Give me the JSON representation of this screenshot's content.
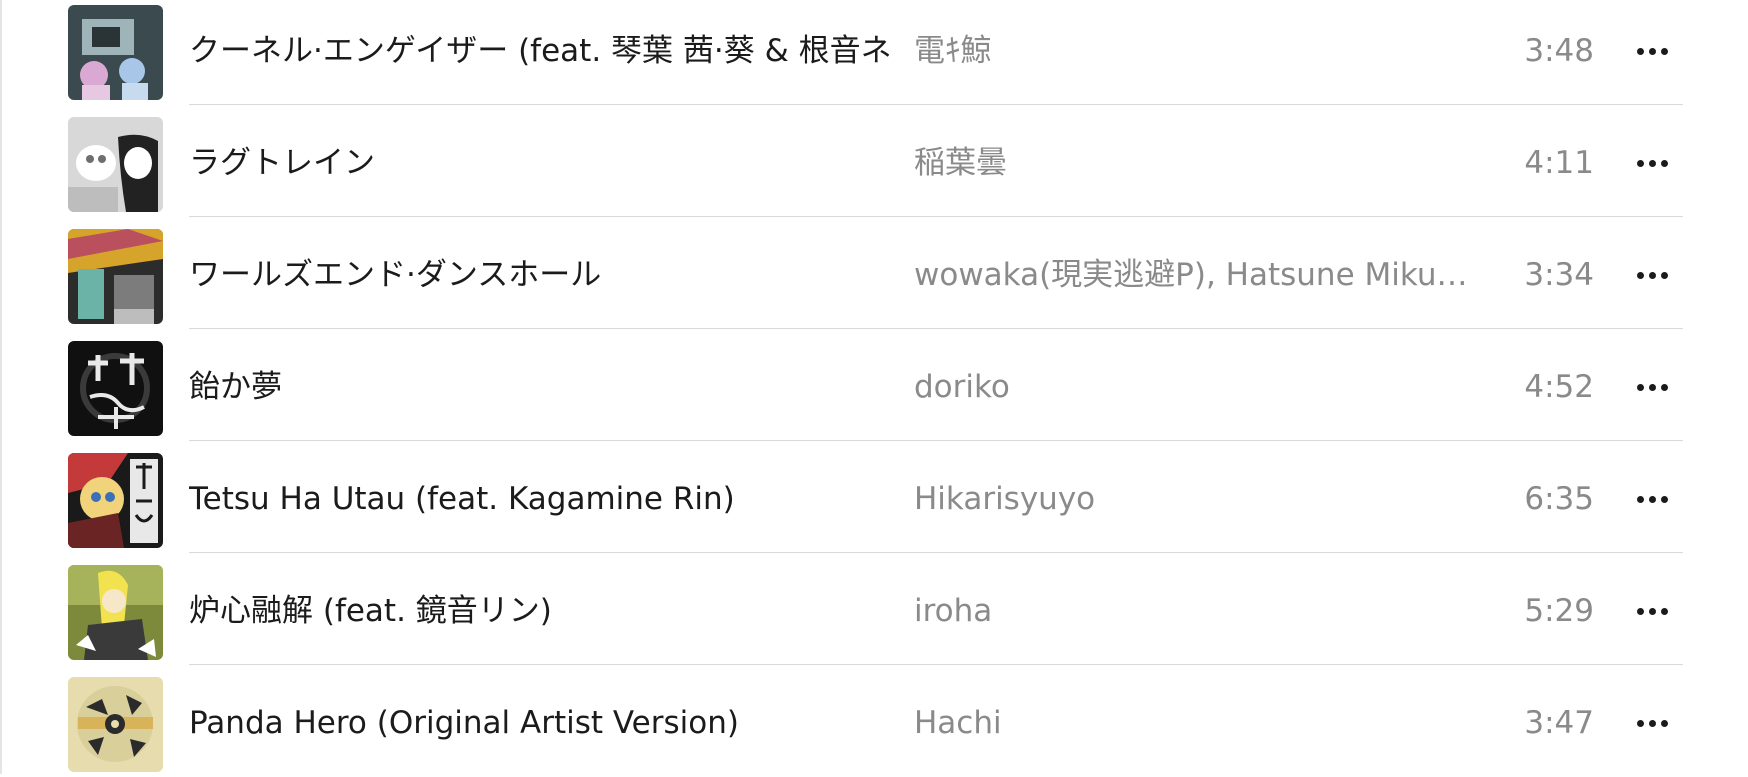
{
  "tracks": [
    {
      "title": "クーネル·エンゲイザー (feat. 琴葉 茜·葵 & 根音ネネ)",
      "artist": "電ｷ鯨",
      "duration": "3:48",
      "artwork_icon": "album-art-1",
      "art_colors": [
        "#3b4a4f",
        "#9fb4b9",
        "#d9a9d4"
      ]
    },
    {
      "title": "ラグトレイン",
      "artist": "稲葉曇",
      "duration": "4:11",
      "artwork_icon": "album-art-2",
      "art_colors": [
        "#d8d8d8",
        "#ffffff",
        "#222222"
      ]
    },
    {
      "title": "ワールズエンド·ダンスホール",
      "artist": "wowaka(現実逃避P), Hatsune Miku &...",
      "duration": "3:34",
      "artwork_icon": "album-art-3",
      "art_colors": [
        "#2c2c2c",
        "#6ab3a6",
        "#d6a42a"
      ]
    },
    {
      "title": "飴か夢",
      "artist": "doriko",
      "duration": "4:52",
      "artwork_icon": "album-art-4",
      "art_colors": [
        "#101010",
        "#e9e9e9",
        "#3a3a3a"
      ]
    },
    {
      "title": "Tetsu Ha Utau (feat. Kagamine Rin)",
      "artist": "Hikarisyuyo",
      "duration": "6:35",
      "artwork_icon": "album-art-5",
      "art_colors": [
        "#1a1a1a",
        "#c43a3a",
        "#f1d37b"
      ]
    },
    {
      "title": "炉心融解 (feat. 鏡音リン)",
      "artist": "iroha",
      "duration": "5:29",
      "artwork_icon": "album-art-6",
      "art_colors": [
        "#7e8a3b",
        "#f2e24f",
        "#3a3a3a"
      ]
    },
    {
      "title": "Panda Hero (Original Artist Version)",
      "artist": "Hachi",
      "duration": "3:47",
      "artwork_icon": "album-art-7",
      "art_colors": [
        "#e6dcae",
        "#2b2b2b",
        "#d9b35a"
      ]
    }
  ],
  "more_icon": "ellipsis-icon"
}
